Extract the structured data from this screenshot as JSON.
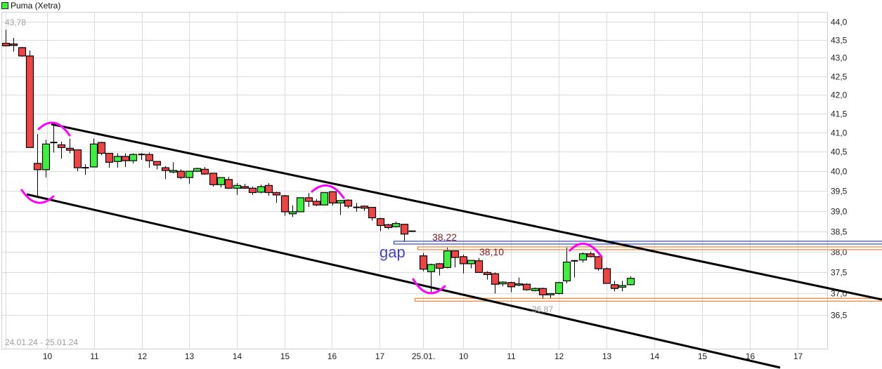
{
  "chart_data": {
    "type": "candlestick",
    "title": "Puma (Xetra)",
    "date_range_label": "24.01.24 - 25.01.24",
    "y_scale": "log",
    "ylim": [
      36.0,
      44.2
    ],
    "yticks": [
      "44,0",
      "43,5",
      "43,0",
      "42,5",
      "42,0",
      "41,5",
      "41,0",
      "40,5",
      "40,0",
      "39,5",
      "39,0",
      "38,5",
      "38,0",
      "37,5",
      "37,0",
      "36,5"
    ],
    "ytick_values": [
      44.0,
      43.5,
      43.0,
      42.5,
      42.0,
      41.5,
      41.0,
      40.5,
      40.0,
      39.5,
      39.0,
      38.5,
      38.0,
      37.5,
      37.0,
      36.5
    ],
    "xticks": [
      {
        "day": 0,
        "label": "10",
        "hour": 10
      },
      {
        "day": 0,
        "label": "11",
        "hour": 11
      },
      {
        "day": 0,
        "label": "12",
        "hour": 12
      },
      {
        "day": 0,
        "label": "13",
        "hour": 13
      },
      {
        "day": 0,
        "label": "14",
        "hour": 14
      },
      {
        "day": 0,
        "label": "15",
        "hour": 15
      },
      {
        "day": 0,
        "label": "16",
        "hour": 16
      },
      {
        "day": 0,
        "label": "17",
        "hour": 17
      },
      {
        "day": 1,
        "label": "25.01.",
        "hour": 9
      },
      {
        "day": 1,
        "label": "10",
        "hour": 10
      },
      {
        "day": 1,
        "label": "11",
        "hour": 11
      },
      {
        "day": 1,
        "label": "12",
        "hour": 12
      },
      {
        "day": 1,
        "label": "13",
        "hour": 13
      },
      {
        "day": 1,
        "label": "14",
        "hour": 14
      },
      {
        "day": 1,
        "label": "15",
        "hour": 15
      },
      {
        "day": 1,
        "label": "16",
        "hour": 16
      },
      {
        "day": 1,
        "label": "17",
        "hour": 17
      }
    ],
    "grid": true,
    "legend": "top-left",
    "colors": {
      "up": "#3ef03e",
      "down": "#f04444",
      "outline": "#000000",
      "trendline": "#000000",
      "marker": "#ff00ff",
      "gap_line": "#3344cc",
      "level_line": "#f08030"
    },
    "days": [
      {
        "date": "24.01.24",
        "candles_ohlc": [
          [
            43.4,
            43.78,
            43.32,
            43.33
          ],
          [
            43.38,
            43.55,
            43.17,
            43.34
          ],
          [
            43.28,
            43.3,
            43.03,
            43.05
          ],
          [
            43.05,
            43.2,
            40.61,
            40.61
          ],
          [
            40.2,
            40.96,
            39.33,
            40.04
          ],
          [
            40.04,
            40.81,
            39.84,
            40.7
          ],
          [
            40.73,
            41.24,
            40.48,
            40.74
          ],
          [
            40.68,
            40.76,
            40.32,
            40.61
          ],
          [
            40.59,
            40.84,
            40.46,
            40.54
          ],
          [
            40.55,
            40.55,
            40.0,
            40.09
          ],
          [
            40.07,
            40.18,
            39.91,
            40.09
          ],
          [
            40.11,
            40.84,
            40.11,
            40.7
          ],
          [
            40.74,
            40.76,
            40.41,
            40.46
          ],
          [
            40.46,
            40.46,
            40.09,
            40.23
          ],
          [
            40.25,
            40.46,
            40.09,
            40.38
          ],
          [
            40.38,
            40.46,
            40.11,
            40.27
          ],
          [
            40.27,
            40.46,
            40.2,
            40.43
          ],
          [
            40.43,
            40.46,
            40.29,
            40.43
          ],
          [
            40.43,
            40.48,
            40.09,
            40.27
          ],
          [
            40.25,
            40.25,
            40.05,
            40.16
          ],
          [
            40.09,
            40.13,
            39.8,
            40.02
          ],
          [
            39.98,
            40.23,
            39.95,
            40.02
          ],
          [
            40.0,
            40.05,
            39.8,
            39.84
          ],
          [
            39.84,
            40.0,
            39.68,
            40.0
          ],
          [
            40.0,
            40.09,
            39.98,
            40.07
          ],
          [
            40.05,
            40.11,
            39.91,
            39.93
          ],
          [
            39.95,
            39.95,
            39.61,
            39.66
          ],
          [
            39.66,
            39.84,
            39.59,
            39.84
          ],
          [
            39.79,
            39.86,
            39.55,
            39.57
          ],
          [
            39.57,
            39.7,
            39.4,
            39.64
          ],
          [
            39.61,
            39.68,
            39.55,
            39.57
          ],
          [
            39.57,
            39.61,
            39.4,
            39.46
          ],
          [
            39.47,
            39.66,
            39.44,
            39.61
          ],
          [
            39.64,
            39.7,
            39.38,
            39.46
          ],
          [
            39.46,
            39.48,
            39.2,
            39.4
          ],
          [
            39.38,
            39.4,
            38.88,
            38.98
          ],
          [
            38.93,
            39.14,
            38.85,
            38.98
          ],
          [
            38.98,
            39.33,
            38.98,
            39.33
          ],
          [
            39.33,
            39.45,
            39.1,
            39.24
          ],
          [
            39.24,
            39.3,
            39.12,
            39.15
          ],
          [
            39.15,
            39.46,
            39.15,
            39.46
          ],
          [
            39.48,
            39.48,
            39.14,
            39.2
          ],
          [
            39.2,
            39.27,
            38.9,
            39.26
          ],
          [
            39.27,
            39.29,
            39.07,
            39.12
          ],
          [
            39.09,
            39.2,
            38.98,
            39.09
          ],
          [
            39.12,
            39.14,
            39.0,
            39.07
          ],
          [
            39.09,
            39.09,
            38.76,
            38.83
          ],
          [
            38.81,
            38.83,
            38.5,
            38.64
          ],
          [
            38.66,
            38.68,
            38.55,
            38.59
          ],
          [
            38.61,
            38.74,
            38.59,
            38.69
          ],
          [
            38.67,
            38.67,
            38.24,
            38.43
          ],
          [
            38.5,
            38.5,
            38.5,
            38.5
          ]
        ]
      },
      {
        "date": "25.01.24",
        "candles_ohlc": [
          [
            37.9,
            37.97,
            37.53,
            37.58
          ],
          [
            37.52,
            37.71,
            37.03,
            37.69
          ],
          [
            37.71,
            37.73,
            37.43,
            37.6
          ],
          [
            37.62,
            38.1,
            37.6,
            38.02
          ],
          [
            38.02,
            38.03,
            37.62,
            37.86
          ],
          [
            37.88,
            37.93,
            37.48,
            37.71
          ],
          [
            37.71,
            37.79,
            37.6,
            37.79
          ],
          [
            37.78,
            37.85,
            37.5,
            37.5
          ],
          [
            37.5,
            37.53,
            37.33,
            37.45
          ],
          [
            37.47,
            37.5,
            37.0,
            37.22
          ],
          [
            37.23,
            37.29,
            37.17,
            37.27
          ],
          [
            37.26,
            37.28,
            37.03,
            37.16
          ],
          [
            37.2,
            37.38,
            37.17,
            37.23
          ],
          [
            37.22,
            37.24,
            37.07,
            37.09
          ],
          [
            37.07,
            37.14,
            37.05,
            37.12
          ],
          [
            37.12,
            37.14,
            36.87,
            36.97
          ],
          [
            36.97,
            37.0,
            36.88,
            37.0
          ],
          [
            37.0,
            37.28,
            36.98,
            37.26
          ],
          [
            37.3,
            38.1,
            37.24,
            37.75
          ],
          [
            37.77,
            37.8,
            37.38,
            37.78
          ],
          [
            37.8,
            37.98,
            37.74,
            37.95
          ],
          [
            37.95,
            38.0,
            37.86,
            37.88
          ],
          [
            37.88,
            37.9,
            37.54,
            37.59
          ],
          [
            37.59,
            37.62,
            37.24,
            37.24
          ],
          [
            37.21,
            37.3,
            37.05,
            37.12
          ],
          [
            37.15,
            37.3,
            37.05,
            37.19
          ],
          [
            37.21,
            37.41,
            37.19,
            37.36
          ]
        ]
      }
    ],
    "annotations": {
      "high_label": "43,78",
      "low_label": "36,87",
      "gap_text": "gap",
      "gap_level": {
        "value": 38.22,
        "label": "38.22"
      },
      "resistance_level": {
        "value": 38.1,
        "label": "38,10"
      },
      "support_level": {
        "value": 36.87
      }
    }
  }
}
